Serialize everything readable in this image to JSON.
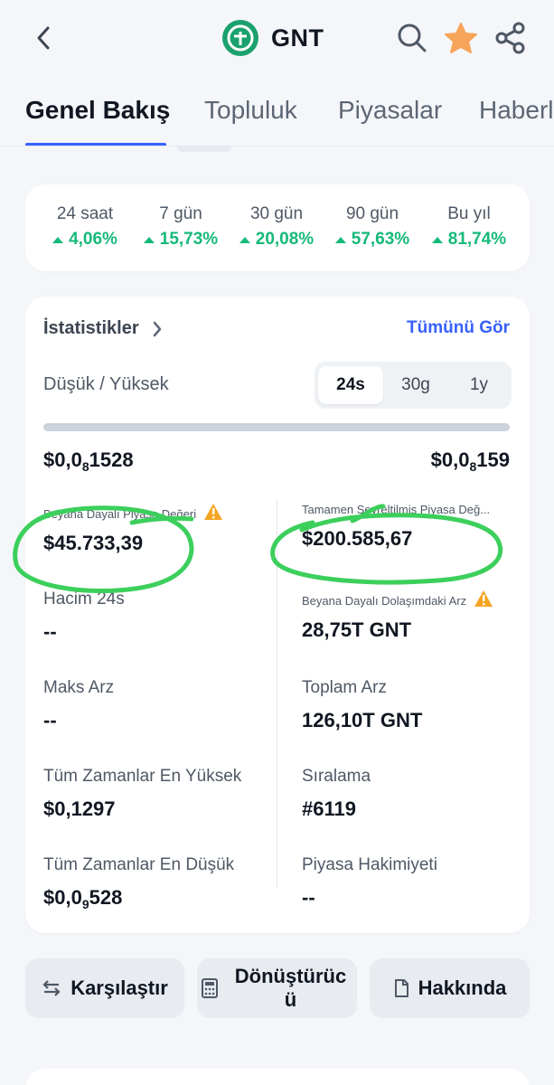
{
  "header": {
    "title": "GNT",
    "back_icon": "chevron-left-icon",
    "logo_icon": "gnt-logo-icon",
    "search_icon": "search-icon",
    "favorite_icon": "star-icon",
    "share_icon": "share-icon"
  },
  "tabs": [
    {
      "label": "Genel Bakış",
      "active": true
    },
    {
      "label": "Topluluk",
      "active": false
    },
    {
      "label": "Piyasalar",
      "active": false
    },
    {
      "label": "Haberler",
      "active": false
    }
  ],
  "performance": [
    {
      "label": "24 saat",
      "value": "4,06%"
    },
    {
      "label": "7 gün",
      "value": "15,73%"
    },
    {
      "label": "30 gün",
      "value": "20,08%"
    },
    {
      "label": "90 gün",
      "value": "57,63%"
    },
    {
      "label": "Bu yıl",
      "value": "81,74%"
    }
  ],
  "stats": {
    "title": "İstatistikler",
    "view_all": "Tümünü Gör",
    "range_label": "Düşük / Yüksek",
    "periods": [
      {
        "label": "24s",
        "active": true
      },
      {
        "label": "30g",
        "active": false
      },
      {
        "label": "1y",
        "active": false
      }
    ],
    "range_low": {
      "prefix": "$0,0",
      "sub": "8",
      "rest": "1528"
    },
    "range_high": {
      "prefix": "$0,0",
      "sub": "8",
      "rest": "159"
    },
    "left": [
      {
        "label": "Beyana Dayalı Piyasa Değeri",
        "value": "$45.733,39"
      },
      {
        "label": "Hacim 24s",
        "value": "--"
      },
      {
        "label": "Maks Arz",
        "value": "--"
      },
      {
        "label": "Tüm Zamanlar En Yüksek",
        "value": "$0,1297"
      },
      {
        "label": "Tüm Zamanlar En Düşük",
        "value_prefix": "$0,0",
        "value_sub": "9",
        "value_rest": "528"
      }
    ],
    "right": [
      {
        "label": "Tamamen Seyreltilmiş Piyasa Değ...",
        "value": "$200.585,67"
      },
      {
        "label": "Beyana Dayalı Dolaşımdaki Arz",
        "value": "28,75T GNT"
      },
      {
        "label": "Toplam Arz",
        "value": "126,10T GNT"
      },
      {
        "label": "Sıralama",
        "value": "#6119"
      },
      {
        "label": "Piyasa Hakimiyeti",
        "value": "--"
      }
    ],
    "warning_icon": "warning-icon",
    "annotation_color": "#3ccf5c"
  },
  "actions": [
    {
      "label": "Karşılaştır",
      "icon": "compare-arrows-icon"
    },
    {
      "label": "Dönüştürüc ü",
      "icon": "calculator-icon"
    },
    {
      "label": "Hakkında",
      "icon": "document-icon"
    }
  ],
  "colors": {
    "accent": "#3861fb",
    "positive": "#16b979",
    "warning": "#f5a524",
    "star": "#f6a45a",
    "logo": "#1aa16d"
  }
}
